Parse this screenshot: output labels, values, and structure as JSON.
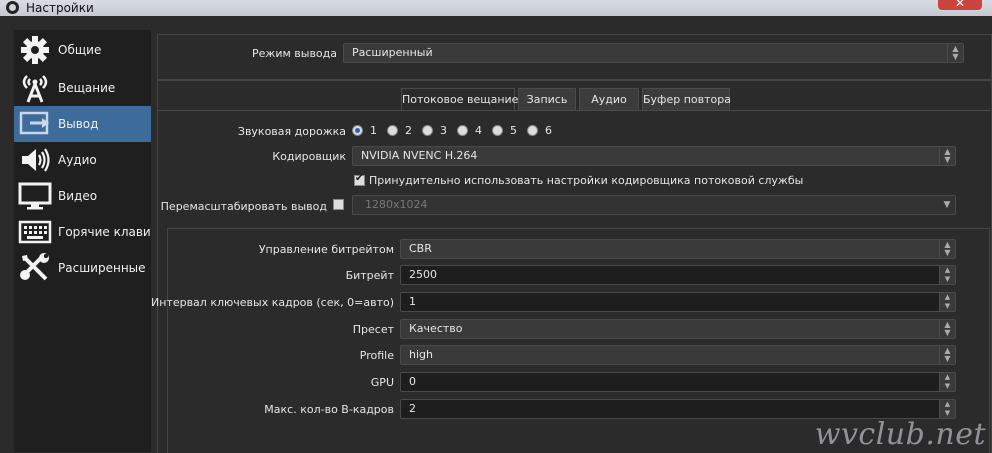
{
  "window": {
    "title": "Настройки",
    "close_glyph": "✕"
  },
  "sidebar": {
    "items": [
      {
        "label": "Общие",
        "icon": "gear-icon",
        "active": false
      },
      {
        "label": "Вещание",
        "icon": "broadcast-icon",
        "active": false
      },
      {
        "label": "Вывод",
        "icon": "output-icon",
        "active": true
      },
      {
        "label": "Аудио",
        "icon": "speaker-icon",
        "active": false
      },
      {
        "label": "Видео",
        "icon": "monitor-icon",
        "active": false
      },
      {
        "label": "Горячие клавиш",
        "icon": "keyboard-icon",
        "active": false
      },
      {
        "label": "Расширенные",
        "icon": "tools-icon",
        "active": false
      }
    ]
  },
  "output_mode": {
    "label": "Режим вывода",
    "value": "Расширенный"
  },
  "tabs": [
    {
      "label": "Потоковое вещание",
      "active": true
    },
    {
      "label": "Запись",
      "active": false
    },
    {
      "label": "Аудио",
      "active": false
    },
    {
      "label": "Буфер повтора",
      "active": false
    }
  ],
  "streaming": {
    "audio_track": {
      "label": "Звуковая дорожка",
      "options": [
        "1",
        "2",
        "3",
        "4",
        "5",
        "6"
      ],
      "selected": "1"
    },
    "encoder": {
      "label": "Кодировщик",
      "value": "NVIDIA NVENC H.264"
    },
    "enforce": {
      "label": "Принудительно использовать настройки кодировщика потоковой службы",
      "checked": true
    },
    "rescale": {
      "label": "Перемасштабировать вывод",
      "checked": false,
      "value": "1280x1024"
    }
  },
  "encoder_settings": {
    "rate_control": {
      "label": "Управление битрейтом",
      "value": "CBR"
    },
    "bitrate": {
      "label": "Битрейт",
      "value": "2500"
    },
    "keyframe": {
      "label": "Интервал ключевых кадров (сек, 0=авто)",
      "value": "1"
    },
    "preset": {
      "label": "Пресет",
      "value": "Качество"
    },
    "profile": {
      "label": "Profile",
      "value": "high"
    },
    "gpu": {
      "label": "GPU",
      "value": "0"
    },
    "bframes": {
      "label": "Макс. кол-во B-кадров",
      "value": "2"
    }
  },
  "watermark": "wvclub.net",
  "colors": {
    "accent": "#3d6b9a",
    "panel": "#2b2b2b",
    "sidebar": "#1f1f1f"
  }
}
